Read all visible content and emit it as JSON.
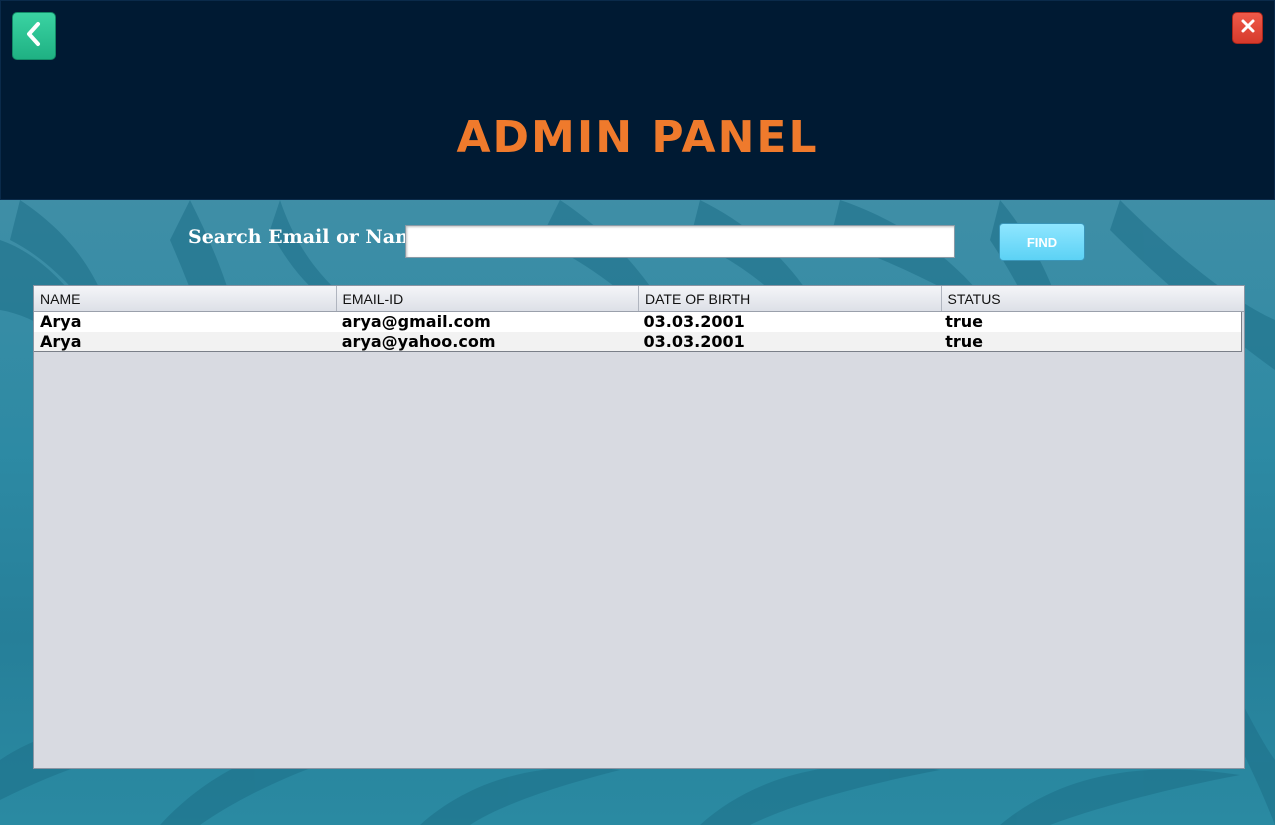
{
  "window": {
    "title": "ADMIN PANEL",
    "back_icon": "chevron-left-icon",
    "close_icon": "close-icon"
  },
  "search": {
    "label": "Search Email or Name",
    "value": "",
    "placeholder": "",
    "button_label": "FIND"
  },
  "table": {
    "columns": [
      "NAME",
      "EMAIL-ID",
      "DATE OF BIRTH",
      "STATUS"
    ],
    "rows": [
      {
        "name": "Arya",
        "email": "arya@gmail.com",
        "dob": "03.03.2001",
        "status": "true"
      },
      {
        "name": "Arya",
        "email": "arya@yahoo.com",
        "dob": "03.03.2001",
        "status": "true"
      }
    ]
  },
  "colors": {
    "header_bg": "#001a33",
    "title": "#ef7a2c",
    "back_button": "#2cc595",
    "close_button": "#e54a3b",
    "find_button": "#6ad9f8"
  }
}
